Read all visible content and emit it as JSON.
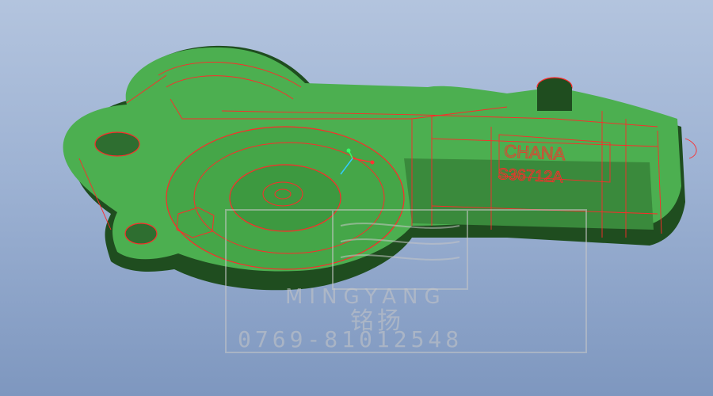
{
  "viewport": {
    "background_top": "#b3c4de",
    "background_bottom": "#7e97bf"
  },
  "model": {
    "body_color": "#4caf50",
    "shadow_color": "#1f4d1f",
    "edge_color": "#ff2a2a",
    "engraving_brand": "CHANA",
    "engraving_part": "S36712A"
  },
  "watermark": {
    "latin": "MINGYANG",
    "cjk": "铭扬",
    "phone": "0769-81012548",
    "color": "#c7c7c7"
  },
  "axis_triad": {
    "x_color": "#ff3333",
    "y_color": "#33ff66",
    "z_color": "#33ccff"
  }
}
